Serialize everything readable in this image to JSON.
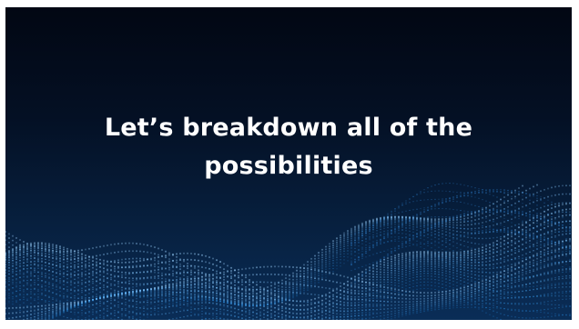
{
  "slide": {
    "title_line1": "Let’s breakdown all of the",
    "title_line2": "possibilities",
    "background_color": "#041024",
    "accent_color": "#1e90ff",
    "decoration": "particle-wave"
  }
}
